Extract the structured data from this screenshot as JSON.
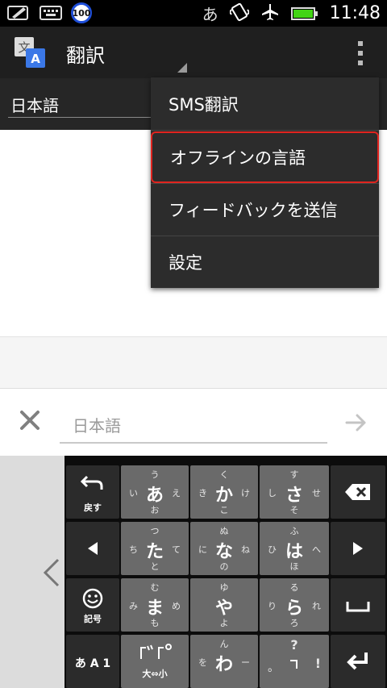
{
  "status_bar": {
    "icons": [
      "edit-icon",
      "keyboard-icon"
    ],
    "badge": "100",
    "input_mode": "あ",
    "clock": "11:48",
    "battery_level": 0.95,
    "battery_color": "#42d414"
  },
  "action_bar": {
    "title": "翻訳"
  },
  "language_bar": {
    "source_language": "日本語"
  },
  "input": {
    "placeholder": "日本語"
  },
  "menu": {
    "items": [
      {
        "label": "SMS翻訳"
      },
      {
        "label": "オフラインの言語"
      },
      {
        "label": "フィードバックを送信"
      },
      {
        "label": "設定"
      }
    ],
    "highlight_color": "#e0241f"
  },
  "keyboard": {
    "back_label": "戻す",
    "symbols_label": "記号",
    "mode_label": "あ A 1",
    "case_label": "大⇔小",
    "keys": {
      "a": {
        "main": "あ",
        "top": "う",
        "left": "い",
        "right": "え",
        "bottom": "お"
      },
      "ka": {
        "main": "か",
        "top": "く",
        "left": "き",
        "right": "け",
        "bottom": "こ"
      },
      "sa": {
        "main": "さ",
        "top": "す",
        "left": "し",
        "right": "せ",
        "bottom": "そ"
      },
      "ta": {
        "main": "た",
        "top": "つ",
        "left": "ち",
        "right": "て",
        "bottom": "と"
      },
      "na": {
        "main": "な",
        "top": "ぬ",
        "left": "に",
        "right": "ね",
        "bottom": "の"
      },
      "ha": {
        "main": "は",
        "top": "ふ",
        "left": "ひ",
        "right": "へ",
        "bottom": "ほ"
      },
      "ma": {
        "main": "ま",
        "top": "む",
        "left": "み",
        "right": "め",
        "bottom": "も"
      },
      "ya": {
        "main": "や",
        "top": "ゆ",
        "left": "",
        "right": "",
        "bottom": "よ"
      },
      "ra": {
        "main": "ら",
        "top": "る",
        "left": "り",
        "right": "れ",
        "bottom": "ろ"
      },
      "wa": {
        "main": "わ",
        "top": "ん",
        "left": "を",
        "right": "ー",
        "bottom": ""
      },
      "punct": {
        "main": "。",
        "top": "?",
        "left": "",
        "right": "!",
        "bottom": ""
      }
    }
  }
}
